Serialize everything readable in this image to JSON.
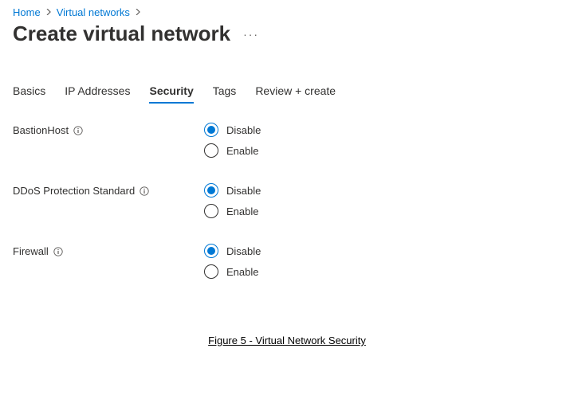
{
  "breadcrumb": {
    "home": "Home",
    "vnets": "Virtual networks"
  },
  "page": {
    "title": "Create virtual network"
  },
  "tabs": {
    "basics": "Basics",
    "ip": "IP Addresses",
    "security": "Security",
    "tags": "Tags",
    "review": "Review + create"
  },
  "fields": {
    "bastion": {
      "label": "BastionHost",
      "options": {
        "disable": "Disable",
        "enable": "Enable"
      },
      "selected": "disable"
    },
    "ddos": {
      "label": "DDoS Protection Standard",
      "options": {
        "disable": "Disable",
        "enable": "Enable"
      },
      "selected": "disable"
    },
    "firewall": {
      "label": "Firewall",
      "options": {
        "disable": "Disable",
        "enable": "Enable"
      },
      "selected": "disable"
    }
  },
  "caption": "Figure 5 - Virtual Network Security "
}
